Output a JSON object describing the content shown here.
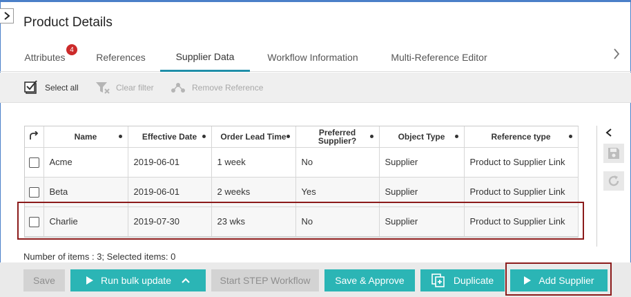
{
  "page": {
    "title": "Product Details"
  },
  "tabs": [
    {
      "label": "Attributes",
      "badge": "4"
    },
    {
      "label": "References"
    },
    {
      "label": "Supplier Data",
      "active": true
    },
    {
      "label": "Workflow Information"
    },
    {
      "label": "Multi-Reference Editor"
    }
  ],
  "toolbar": {
    "select_all": "Select all",
    "clear_filter": "Clear filter",
    "remove_reference": "Remove Reference"
  },
  "table": {
    "columns": [
      "Name",
      "Effective Date",
      "Order Lead Time",
      "Preferred Supplier?",
      "Object Type",
      "Reference type"
    ],
    "rows": [
      {
        "name": "Acme",
        "effective_date": "2019-06-01",
        "order_lead_time": "1 week",
        "preferred": "No",
        "object_type": "Supplier",
        "reference_type": "Product to Supplier Link"
      },
      {
        "name": "Beta",
        "effective_date": "2019-06-01",
        "order_lead_time": "2 weeks",
        "preferred": "Yes",
        "object_type": "Supplier",
        "reference_type": "Product to Supplier Link"
      },
      {
        "name": "Charlie",
        "effective_date": "2019-07-30",
        "order_lead_time": "23 wks",
        "preferred": "No",
        "object_type": "Supplier",
        "reference_type": "Product to Supplier Link"
      }
    ]
  },
  "status": {
    "count_text": "Number of items : 3; Selected items: 0"
  },
  "footer": {
    "save": "Save",
    "run_bulk_update": "Run bulk update",
    "start_step_workflow": "Start STEP Workflow",
    "save_approve": "Save & Approve",
    "duplicate": "Duplicate",
    "add_supplier": "Add Supplier"
  },
  "colors": {
    "accent": "#2bb5b5",
    "tab_underline": "#1f8ea8",
    "highlight": "#8b1a1a",
    "badge": "#cc2a2a"
  }
}
